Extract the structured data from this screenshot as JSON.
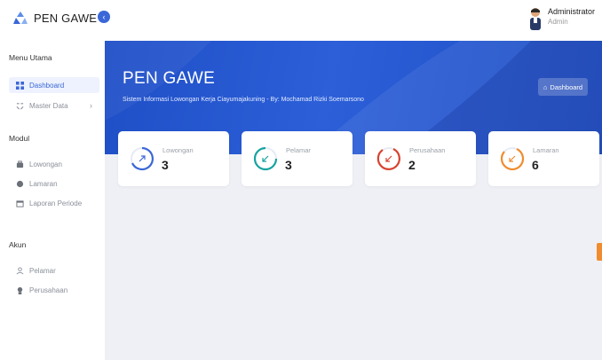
{
  "app": {
    "brand": "PEN GAWE"
  },
  "user": {
    "name": "Administrator",
    "role": "Admin"
  },
  "sidebar": {
    "sections": [
      {
        "title": "Menu Utama"
      },
      {
        "title": "Modul"
      },
      {
        "title": "Akun"
      }
    ],
    "items": [
      {
        "label": "Dashboard",
        "icon": "dashboard-icon",
        "active": true
      },
      {
        "label": "Master Data",
        "icon": "master-data-icon",
        "has_children": true
      },
      {
        "label": "Lowongan",
        "icon": "briefcase-icon"
      },
      {
        "label": "Lamaran",
        "icon": "document-icon"
      },
      {
        "label": "Laporan Periode",
        "icon": "calendar-icon"
      },
      {
        "label": "Pelamar",
        "icon": "user-icon"
      },
      {
        "label": "Perusahaan",
        "icon": "building-icon"
      }
    ]
  },
  "hero": {
    "title": "PEN GAWE",
    "subtitle": "Sistem Informasi Lowongan Kerja Ciayumajakuning - By: Mochamad Rizki Soemarsono",
    "button_label": "Dashboard"
  },
  "stats": [
    {
      "label": "Lowongan",
      "value": "3",
      "color": "#3b67d8",
      "icon": "arrow-up-right-icon"
    },
    {
      "label": "Pelamar",
      "value": "3",
      "color": "#16a3a0",
      "icon": "arrow-down-left-icon"
    },
    {
      "label": "Perusahaan",
      "value": "2",
      "color": "#d8432f",
      "icon": "arrow-down-left-icon"
    },
    {
      "label": "Lamaran",
      "value": "6",
      "color": "#f08c2e",
      "icon": "arrow-down-left-icon"
    }
  ],
  "colors": {
    "primary": "#2c5fd8",
    "accent": "#f08c2e",
    "background": "#eef0f5"
  }
}
